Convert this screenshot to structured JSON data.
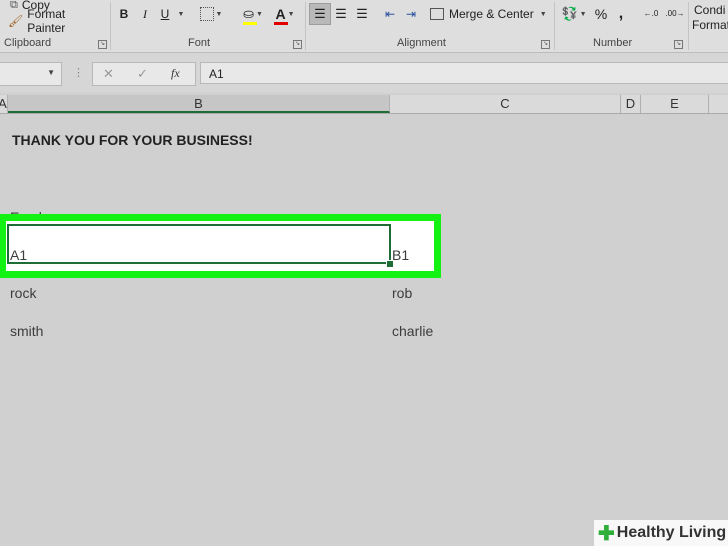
{
  "ribbon": {
    "copy_label": "Copy",
    "format_painter_label": "Format Painter",
    "bold": "B",
    "italic": "I",
    "underline": "U",
    "font_color_letter": "A",
    "merge_center_label": "Merge & Center",
    "percent": "%",
    "comma": ",",
    "decimal_increase": "←.0",
    "decimal_decrease": ".00→",
    "cond_format_line1": "Condi",
    "cond_format_line2": "Format",
    "groups": {
      "clipboard": "Clipboard",
      "font": "Font",
      "alignment": "Alignment",
      "number": "Number"
    },
    "colors": {
      "highlight": "#ffff00",
      "font_color": "#e00000"
    }
  },
  "formula_bar": {
    "cancel_glyph": "✕",
    "enter_glyph": "✓",
    "fx_label": "fx",
    "content": "A1"
  },
  "columns": [
    "A",
    "B",
    "C",
    "D",
    "E"
  ],
  "sheet": {
    "title": "THANK YOU FOR YOUR BUSINESS!",
    "header_partial": "Employee name",
    "row1": {
      "b": "A1",
      "c": "B1"
    },
    "row2": {
      "b": "rock",
      "c": "rob"
    },
    "row3": {
      "b": "smith",
      "c": "charlie"
    }
  },
  "highlight_color": "#14f214",
  "watermark": {
    "brand": "Healthy Living"
  }
}
